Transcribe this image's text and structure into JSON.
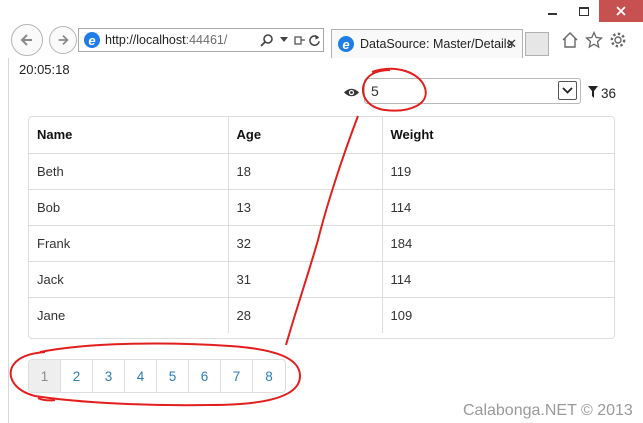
{
  "browser": {
    "url_host": "http://localhost",
    "url_port": ":44461/",
    "tab_title": "DataSource: Master/Details",
    "tab_close": "✕"
  },
  "page": {
    "clock": "20:05:18",
    "page_size": "5",
    "filter_count": "36"
  },
  "table": {
    "headers": [
      "Name",
      "Age",
      "Weight"
    ],
    "rows": [
      [
        "Beth",
        "18",
        "119"
      ],
      [
        "Bob",
        "13",
        "114"
      ],
      [
        "Frank",
        "32",
        "184"
      ],
      [
        "Jack",
        "31",
        "114"
      ],
      [
        "Jane",
        "28",
        "109"
      ]
    ]
  },
  "pager": {
    "pages": [
      "1",
      "2",
      "3",
      "4",
      "5",
      "6",
      "7",
      "8"
    ],
    "active": "1"
  },
  "watermark": "Calabonga.NET © 2013",
  "colors": {
    "link": "#2a7ec0",
    "annotation": "#e31e1e",
    "close_button": "#c75050"
  },
  "icons": [
    "back-arrow-icon",
    "forward-arrow-icon",
    "ie-logo-icon",
    "search-icon",
    "refresh-icon",
    "home-icon",
    "star-icon",
    "gear-icon",
    "eye-icon",
    "filter-icon",
    "chevron-down-icon"
  ]
}
